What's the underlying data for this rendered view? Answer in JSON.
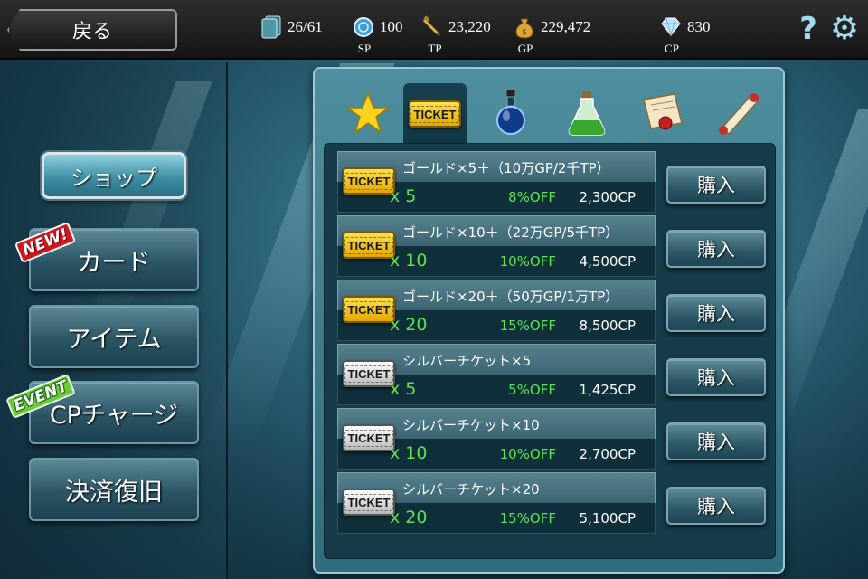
{
  "topbar": {
    "back_label": "戻る",
    "cards": "26/61",
    "sp": {
      "value": "100",
      "label": "SP"
    },
    "tp": {
      "value": "23,220",
      "label": "TP"
    },
    "gp": {
      "value": "229,472",
      "label": "GP"
    },
    "cp": {
      "value": "830",
      "label": "CP"
    },
    "help_glyph": "?",
    "gear_glyph": "⚙"
  },
  "nav": {
    "shop": "ショップ",
    "card": "カード",
    "item": "アイテム",
    "cp_charge": "CPチャージ",
    "restore": "決済復旧",
    "badge_new": "NEW!",
    "badge_event": "EVENT"
  },
  "tabs": {
    "ticket_label": "TICKET",
    "icons": [
      "star-icon",
      "ticket-icon",
      "potion-icon",
      "green-potion-icon",
      "scroll-seal-icon",
      "scroll-icon"
    ]
  },
  "shop_items": [
    {
      "name": "ゴールド×5＋（10万GP/2千TP）",
      "qty": "x 5",
      "discount": "8%OFF",
      "price": "2,300CP",
      "ticket_type": "gold",
      "ticket_label": "TICKET",
      "buy": "購入"
    },
    {
      "name": "ゴールド×10＋（22万GP/5千TP）",
      "qty": "x 10",
      "discount": "10%OFF",
      "price": "4,500CP",
      "ticket_type": "gold",
      "ticket_label": "TICKET",
      "buy": "購入"
    },
    {
      "name": "ゴールド×20＋（50万GP/1万TP）",
      "qty": "x 20",
      "discount": "15%OFF",
      "price": "8,500CP",
      "ticket_type": "gold",
      "ticket_label": "TICKET",
      "buy": "購入"
    },
    {
      "name": "シルバーチケット×5",
      "qty": "x 5",
      "discount": "5%OFF",
      "price": "1,425CP",
      "ticket_type": "silver",
      "ticket_label": "TICKET",
      "buy": "購入"
    },
    {
      "name": "シルバーチケット×10",
      "qty": "x 10",
      "discount": "10%OFF",
      "price": "2,700CP",
      "ticket_type": "silver",
      "ticket_label": "TICKET",
      "buy": "購入"
    },
    {
      "name": "シルバーチケット×20",
      "qty": "x 20",
      "discount": "15%OFF",
      "price": "5,100CP",
      "ticket_type": "silver",
      "ticket_label": "TICKET",
      "buy": "購入"
    }
  ],
  "colors": {
    "discount": "#5ee44f",
    "gold_ticket": "#f5c518",
    "silver_ticket": "#d8d8d8",
    "accent": "#9fdcf0"
  }
}
